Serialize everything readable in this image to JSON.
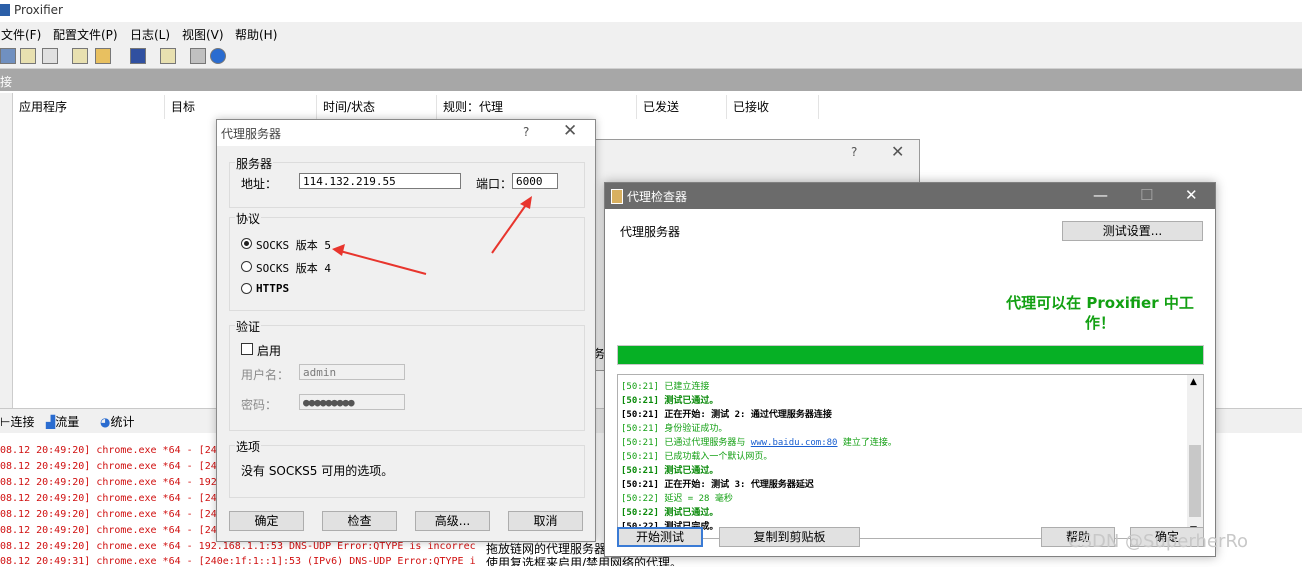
{
  "app": {
    "title": "Proxifier"
  },
  "menu": [
    "文件(F)",
    "配置文件(P)",
    "日志(L)",
    "视图(V)",
    "帮助(H)"
  ],
  "section_label": "接",
  "columns": [
    "应用程序",
    "目标",
    "时间/状态",
    "规则：代理",
    "已发送",
    "已接收"
  ],
  "bottom_tabs": [
    "连接",
    "流量",
    "统计"
  ],
  "log_lines": [
    "08.12 20:49:20] chrome.exe *64 - [24",
    "08.12 20:49:20] chrome.exe *64 - [24",
    "08.12 20:49:20] chrome.exe *64 - 192",
    "08.12 20:49:20] chrome.exe *64 - [24",
    "08.12 20:49:20] chrome.exe *64 - [24",
    "08.12 20:49:20] chrome.exe *64 - [24",
    "08.12 20:49:20] chrome.exe *64 - 192.168.1.1:53 DNS-UDP Error:QTYPE is incorrec",
    "08.12 20:49:31] chrome.exe *64 - [240e:1f:1::1]:53 (IPv6) DNS-UDP Error:QTYPE i"
  ],
  "hidden_text": {
    "line1": "拖放链网的代理服务器",
    "line2": "使用复选框来启用/禁用网络的代理。",
    "fragment": "务"
  },
  "back_dialog": {
    "help": "?"
  },
  "proxy_dialog": {
    "title": "代理服务器",
    "help": "?",
    "server_group": "服务器",
    "address_label": "地址：",
    "address_value": "114.132.219.55",
    "port_label": "端口：",
    "port_value": "6000",
    "protocol_group": "协议",
    "protocols": [
      "SOCKS 版本 5",
      "SOCKS 版本 4",
      "HTTPS"
    ],
    "auth_group": "验证",
    "enable_label": "启用",
    "username_label": "用户名：",
    "username_value": "admin",
    "password_label": "密码：",
    "password_value": "●●●●●●●●●",
    "options_group": "选项",
    "options_text": "没有 SOCKS5 可用的选项。",
    "buttons": [
      "确定",
      "检查",
      "高级...",
      "取消"
    ]
  },
  "checker": {
    "title": "代理检查器",
    "heading": "代理服务器",
    "test_settings": "测试设置...",
    "success_line1": "代理可以在 Proxifier 中工",
    "success_line2": "作！",
    "progress": 1.0,
    "log": [
      "[50:21] 已建立连接",
      "[50:21] 测试已通过。",
      "[50:21] 正在开始: 测试 2: 通过代理服务器连接",
      "[50:21] 身份验证成功。",
      "[50:21] 已通过代理服务器与",
      "www.baidu.com:80",
      "建立了连接。",
      "[50:21] 已成功载入一个默认网页。",
      "[50:21] 测试已通过。",
      "[50:21] 正在开始: 测试 3: 代理服务器延迟",
      "[50:22] 延迟 = 28 毫秒",
      "[50:22] 测试已通过。",
      "[50:22] 测试已完成。"
    ],
    "buttons": [
      "开始测试",
      "复制到剪贴板",
      "帮助",
      "确定"
    ]
  },
  "watermark": "CSDN @SuperherRo",
  "colors": {
    "success": "#12a012",
    "progress": "#06b025",
    "log_error": "#d01010"
  }
}
